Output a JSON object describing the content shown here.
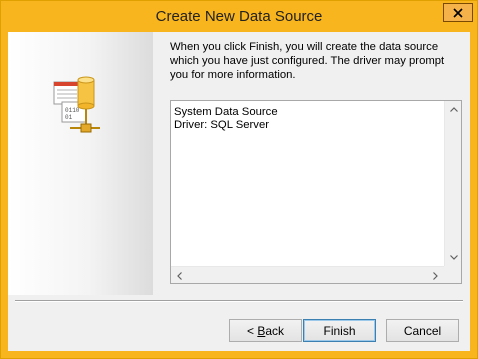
{
  "window": {
    "title": "Create New Data Source"
  },
  "intro_text": "When you click Finish, you will create the data source which you have just configured.  The driver may prompt you for more information.",
  "summary": {
    "lines": [
      "System Data Source",
      "Driver:  SQL Server"
    ]
  },
  "buttons": {
    "back_prefix": "< ",
    "back_mnemonic": "B",
    "back_rest": "ack",
    "finish": "Finish",
    "cancel": "Cancel"
  },
  "icons": {
    "close": "close-icon",
    "illustration": "data-source-illustration-icon",
    "scroll_up": "scroll-up-arrow-icon",
    "scroll_down": "scroll-down-arrow-icon",
    "scroll_left": "scroll-left-arrow-icon",
    "scroll_right": "scroll-right-arrow-icon"
  },
  "colors": {
    "titlebar": "#f9b51d",
    "default_button_border": "#3c7fb1"
  }
}
